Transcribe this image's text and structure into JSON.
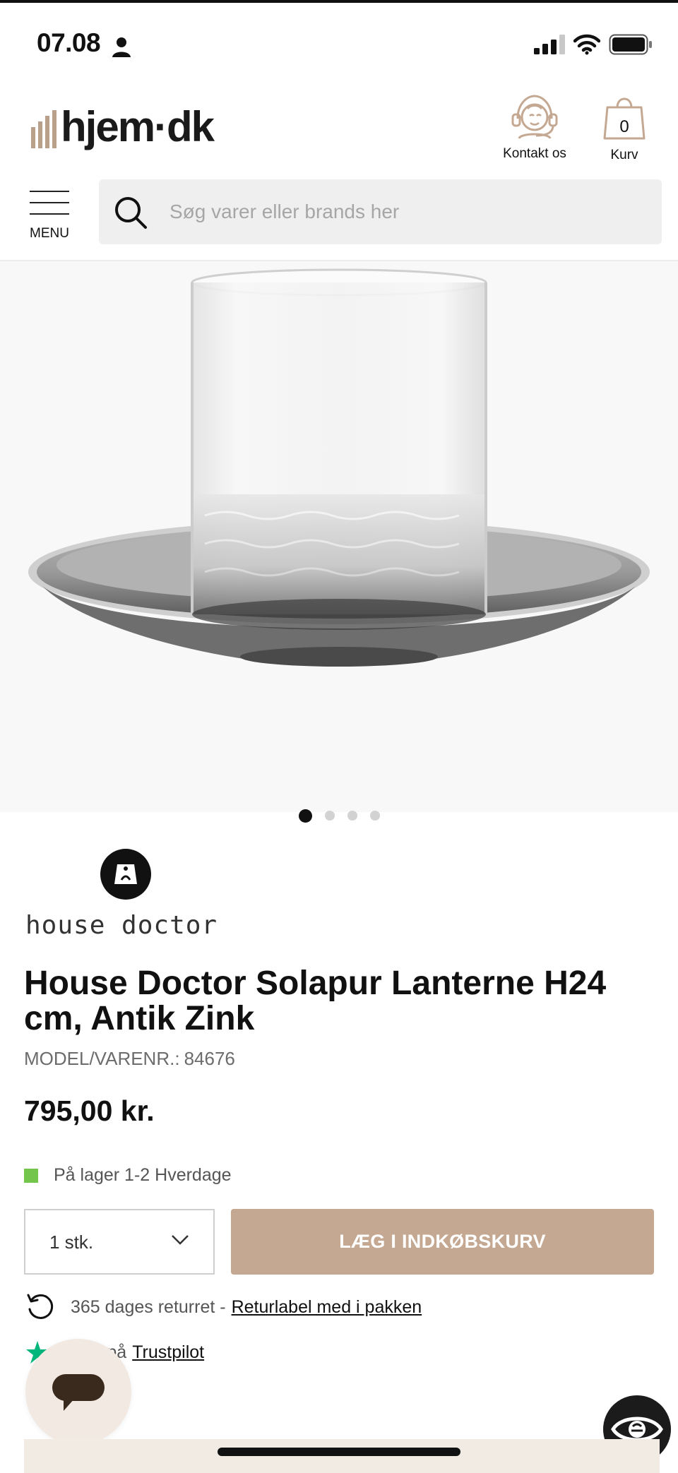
{
  "status_bar": {
    "time": "07.08",
    "icons": [
      "person-icon",
      "signal-icon",
      "wifi-icon",
      "battery-icon"
    ]
  },
  "header": {
    "logo_text": "hjem·dk",
    "contact_label": "Kontakt os",
    "cart_label": "Kurv",
    "cart_count": "0"
  },
  "nav": {
    "menu_label": "MENU",
    "search_placeholder": "Søg varer eller brands her"
  },
  "gallery": {
    "image_count": 4,
    "active_index": 0
  },
  "product": {
    "brand": "house doctor",
    "title": "House Doctor Solapur Lanterne H24 cm, Antik Zink",
    "model_label": "MODEL/VARENR.:",
    "model_number": "84676",
    "price": "795,00 kr.",
    "stock_text": "På lager 1-2 Hverdage",
    "quantity": "1 stk.",
    "add_to_cart_label": "LÆG I INDKØBSKURV"
  },
  "benefits": {
    "returns_text": "365 dages returret -",
    "returns_link": "Returlabel med i pakken",
    "trustpilot_text": "rner på",
    "trustpilot_link": "Trustpilot"
  },
  "colors": {
    "accent": "#c4a892",
    "stock_green": "#74c54c",
    "search_bg": "#efefef",
    "chat_bg": "#f1e9e2"
  }
}
